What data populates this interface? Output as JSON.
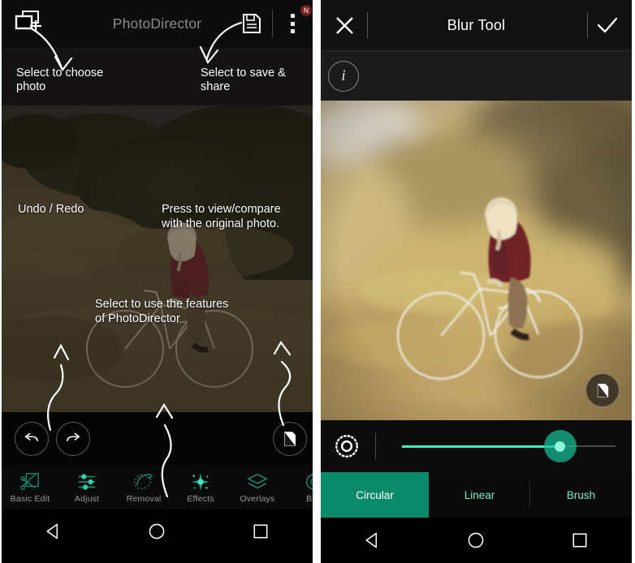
{
  "left_panel": {
    "appbar": {
      "title": "PhotoDirector",
      "add_photo_icon": "add-photo-icon",
      "save_icon": "save-icon",
      "overflow_icon": "overflow-menu-icon",
      "badge": "N"
    },
    "hints": {
      "choose_photo": "Select to choose\nphoto",
      "save_share": "Select to save &\nshare",
      "undo_redo": "Undo / Redo",
      "compare": "Press to view/compare\nwith the original photo.",
      "features": "Select to use the features\nof PhotoDirector"
    },
    "controls": {
      "undo_icon": "undo-arrow-icon",
      "redo_icon": "redo-arrow-icon",
      "compare_icon": "compare-page-icon"
    },
    "feature_rail": [
      {
        "label": "Basic Edit",
        "icon": "scissors-crop-icon"
      },
      {
        "label": "Adjust",
        "icon": "sliders-icon"
      },
      {
        "label": "Removal",
        "icon": "removal-lasso-icon"
      },
      {
        "label": "Effects",
        "icon": "sparkle-effects-icon"
      },
      {
        "label": "Overlays",
        "icon": "layers-icon"
      },
      {
        "label": "Blur",
        "icon": "blur-icon"
      }
    ],
    "navbar": {
      "back": "back-triangle-icon",
      "home": "home-circle-icon",
      "recents": "recents-square-icon"
    }
  },
  "right_panel": {
    "appbar": {
      "title": "Blur Tool",
      "close_icon": "close-x-icon",
      "confirm_icon": "check-icon"
    },
    "info_button": "i",
    "compare_icon": "compare-page-icon",
    "slider": {
      "shape_icon": "circular-dotted-icon",
      "value_percent": 74
    },
    "tabs": [
      {
        "label": "Circular",
        "active": true
      },
      {
        "label": "Linear",
        "active": false
      },
      {
        "label": "Brush",
        "active": false
      }
    ],
    "navbar": {
      "back": "back-triangle-icon",
      "home": "home-circle-icon",
      "recents": "recents-square-icon"
    }
  },
  "colors": {
    "accent_teal": "#0a8a69",
    "slider_mint": "#3df0c0",
    "rail_icon_teal": "#1e7f69",
    "badge_red": "#6e1f1c"
  }
}
